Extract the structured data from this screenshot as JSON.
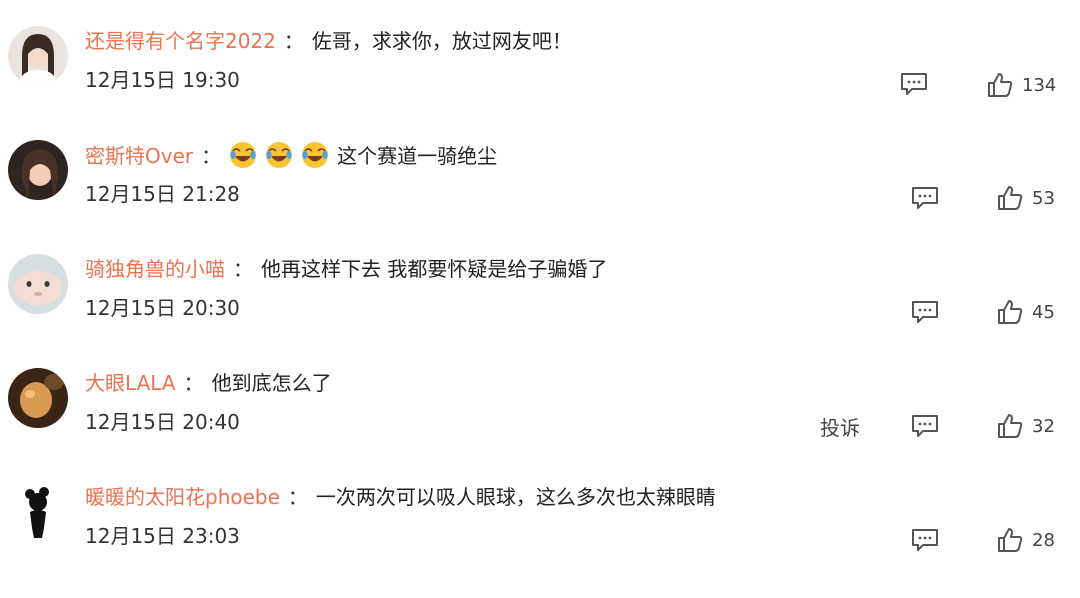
{
  "separator": "：",
  "report_label": "投诉",
  "comments": [
    {
      "username": "还是得有个名字2022",
      "text": "佐哥，求求你，放过网友吧！",
      "time": "12月15日 19:30",
      "likes": "134"
    },
    {
      "username": "密斯特Over",
      "emoji_icon": "laugh-cry-emoji",
      "text": "这个赛道一骑绝尘",
      "time": "12月15日 21:28",
      "likes": "53"
    },
    {
      "username": "骑独角兽的小喵",
      "text": "他再这样下去 我都要怀疑是给子骗婚了",
      "time": "12月15日 20:30",
      "likes": "45"
    },
    {
      "username": "大眼LALA",
      "text": "他到底怎么了",
      "time": "12月15日 20:40",
      "likes": "32"
    },
    {
      "username": "暖暖的太阳花phoebe",
      "text": "一次两次可以吸人眼球，这么多次也太辣眼睛",
      "time": "12月15日 23:03",
      "likes": "28"
    }
  ],
  "colors": {
    "username": "#eb7350",
    "icon": "#555555"
  }
}
